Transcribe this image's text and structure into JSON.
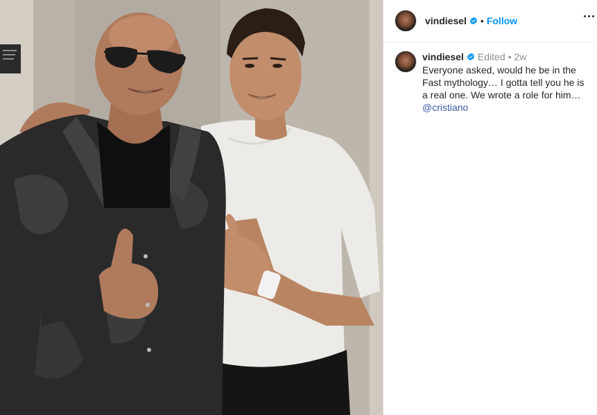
{
  "post": {
    "image_alt": "Two men posing with thumbs up",
    "header": {
      "username": "vindiesel",
      "follow_label": "Follow",
      "separator": "•"
    },
    "caption": {
      "username": "vindiesel",
      "edited_label": "Edited",
      "separator": "•",
      "time_ago": "2w",
      "text": "Everyone asked, would he be in the Fast mythology… I gotta tell you he is a real one.  We wrote a role for him…",
      "mention": "@cristiano"
    },
    "colors": {
      "verified_badge": "#0095f6",
      "follow": "#0095f6",
      "mention": "#3a5aa8",
      "meta": "#8e8e8e"
    },
    "icons": [
      "verified-badge-icon",
      "more-options-icon"
    ]
  }
}
